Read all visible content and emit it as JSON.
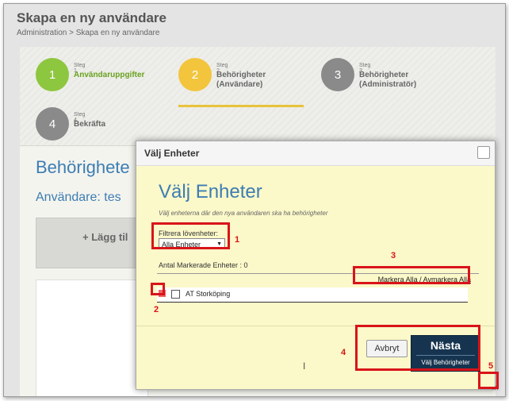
{
  "header": {
    "title": "Skapa en ny användare",
    "breadcrumb": "Administration > Skapa en ny användare"
  },
  "steps": [
    {
      "number": "1",
      "small": "Steg 1",
      "title": "Användaruppgifter",
      "subtitle": ""
    },
    {
      "number": "2",
      "small": "Steg 2",
      "title": "Behörigheter",
      "subtitle": "(Användare)"
    },
    {
      "number": "3",
      "small": "Steg 3",
      "title": "Behörigheter",
      "subtitle": "(Administratör)"
    },
    {
      "number": "4",
      "small": "Steg 4",
      "title": "Bekräfta",
      "subtitle": ""
    }
  ],
  "background": {
    "section_title": "Behörighete",
    "user_label": "Användare: tes",
    "add_button": "+ Lägg til"
  },
  "modal": {
    "titlebar": "Välj Enheter",
    "heading": "Välj Enheter",
    "description": "Välj enheterna där den nya användaren ska ha behörigheter",
    "filter_label": "Filtrera lövenheter:",
    "filter_value": "Alla Enheter",
    "count_label": "Antal Markerade Enheter : 0",
    "mark_all": "Markera Alla",
    "separator": "/",
    "unmark_all": "Avmarkera Alla",
    "unit_name": "AT Storköping",
    "cancel_label": "Avbryt",
    "next_label": "Nästa",
    "next_sub": "Välj Behörigheter"
  },
  "annotations": [
    "1",
    "2",
    "3",
    "4",
    "5"
  ],
  "colors": {
    "annotation": "#d9141a",
    "step_done": "#8dc63f",
    "step_active": "#f2c53d",
    "step_pending": "#8a8a8a",
    "heading_blue": "#3c7db3",
    "modal_bg": "#fbf8c9",
    "next_button": "#16344f"
  }
}
